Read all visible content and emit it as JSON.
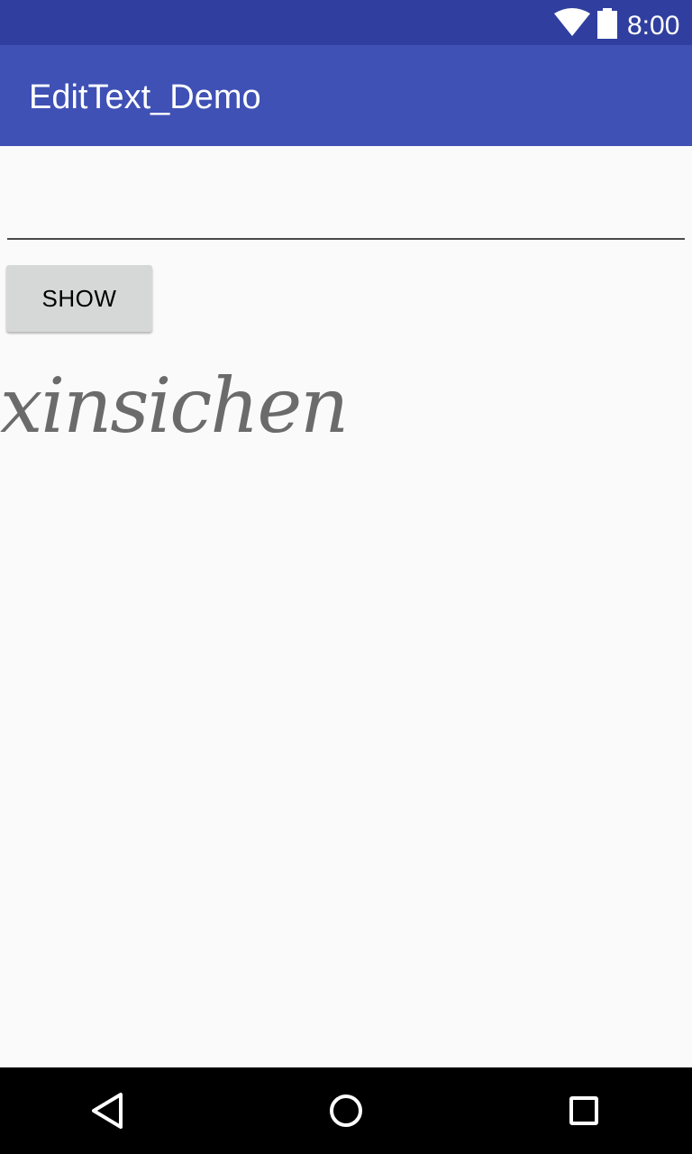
{
  "status_bar": {
    "time": "8:00",
    "icons": [
      "wifi-icon",
      "battery-icon"
    ]
  },
  "app_bar": {
    "title": "EditText_Demo"
  },
  "main": {
    "edit_text": {
      "value": "",
      "placeholder": ""
    },
    "show_button_label": "SHOW",
    "output_text": "xinsichen"
  },
  "nav_bar": {
    "icons": [
      "back-icon",
      "home-icon",
      "recents-icon"
    ]
  },
  "colors": {
    "status_bar": "#303f9f",
    "app_bar": "#3f51b5",
    "background": "#fafafa",
    "button": "#d6d7d7",
    "output_text": "#6b6b6b",
    "nav_bar": "#000000"
  }
}
